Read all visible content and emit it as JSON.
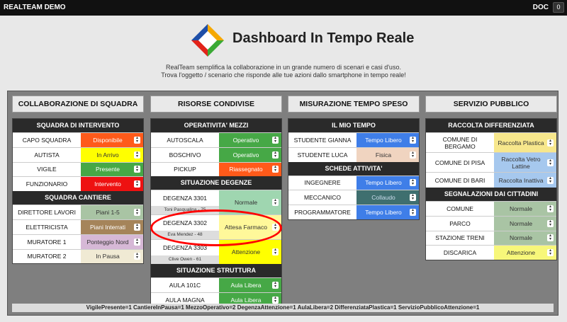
{
  "topbar": {
    "brand": "REALTEAM DEMO",
    "user": "DOC",
    "count": "0"
  },
  "header": {
    "title": "Dashboard In Tempo Reale",
    "subtitle1": "RealTeam semplifica la collaborazione in un grande numero di scenari e casi d'uso.",
    "subtitle2": "Trova l'oggetto / scenario che risponde alle tue azioni dallo smartphone in tempo reale!"
  },
  "columns": [
    {
      "title": "COLLABORAZIONE DI SQUADRA",
      "sections": [
        {
          "title": "SQUADRA DI INTERVENTO",
          "rows": [
            {
              "label": "CAPO SQUADRA",
              "value": "Disponibile"
            },
            {
              "label": "AUTISTA",
              "value": "In Arrivo"
            },
            {
              "label": "VIGILE",
              "value": "Presente"
            },
            {
              "label": "FUNZIONARIO",
              "value": "Intervento"
            }
          ]
        },
        {
          "title": "SQUADRA CANTIERE",
          "rows": [
            {
              "label": "DIRETTORE LAVORI",
              "value": "Piani 1-5"
            },
            {
              "label": "ELETTRICISTA",
              "value": "Piani Interrati"
            },
            {
              "label": "MURATORE 1",
              "value": "Ponteggio Nord"
            },
            {
              "label": "MURATORE 2",
              "value": "In Pausa"
            }
          ]
        }
      ]
    },
    {
      "title": "RISORSE CONDIVISE",
      "sections": [
        {
          "title": "OPERATIVITA' MEZZI",
          "rows": [
            {
              "label": "AUTOSCALA",
              "value": "Operativo"
            },
            {
              "label": "BOSCHIVO",
              "value": "Operativo"
            },
            {
              "label": "PICKUP",
              "value": "Riassegnato"
            }
          ]
        },
        {
          "title": "SITUAZIONE DEGENZE",
          "rows": [
            {
              "label": "DEGENZA 3301",
              "patient": "Toni Pasqualina - 75",
              "value": "Normale"
            },
            {
              "label": "DEGENZA 3302",
              "patient": "Eva Mendez - 48",
              "value": "Attesa Farmaco"
            },
            {
              "label": "DEGENZA 3303",
              "patient": "Clive Owen - 61",
              "value": "Attenzione"
            }
          ]
        },
        {
          "title": "SITUAZIONE STRUTTURA",
          "rows": [
            {
              "label": "AULA 101C",
              "value": "Aula Libera"
            },
            {
              "label": "AULA MAGNA",
              "value": "Aula Libera"
            }
          ]
        }
      ]
    },
    {
      "title": "MISURAZIONE TEMPO SPESO",
      "sections": [
        {
          "title": "IL MIO TEMPO",
          "rows": [
            {
              "label": "STUDENTE GIANNA",
              "value": "Tempo Libero"
            },
            {
              "label": "STUDENTE LUCA",
              "value": "Fisica"
            }
          ]
        },
        {
          "title": "SCHEDE ATTIVITA'",
          "rows": [
            {
              "label": "INGEGNERE",
              "value": "Tempo Libero"
            },
            {
              "label": "MECCANICO",
              "value": "Collaudo"
            },
            {
              "label": "PROGRAMMATORE",
              "value": "Tempo Libero"
            }
          ]
        }
      ]
    },
    {
      "title": "SERVIZIO PUBBLICO",
      "sections": [
        {
          "title": "RACCOLTA DIFFERENZIATA",
          "rows": [
            {
              "label": "COMUNE DI BERGAMO",
              "value": "Raccolta Plastica"
            },
            {
              "label": "COMUNE DI PISA",
              "value": "Raccolta Vetro Lattine"
            },
            {
              "label": "COMUNE DI BARI",
              "value": "Raccolta Inattiva"
            }
          ]
        },
        {
          "title": "SEGNALAZIONI DAI CITTADINI",
          "rows": [
            {
              "label": "COMUNE",
              "value": "Normale"
            },
            {
              "label": "PARCO",
              "value": "Normale"
            },
            {
              "label": "STAZIONE TRENI",
              "value": "Normale"
            },
            {
              "label": "DISCARICA",
              "value": "Attenzione"
            }
          ]
        }
      ]
    }
  ],
  "footer": "VigilePresente=1   CantiereInPausa=1   MezzoOperativo=2   DegenzaAttenzione=1   AulaLibera=2   DifferenziataPlastica=1   ServizioPubblicoAttenzione=1",
  "colors": {
    "accent_highlight": "#ff0000",
    "topbar": "#111111",
    "board": "#7f7f7f"
  }
}
